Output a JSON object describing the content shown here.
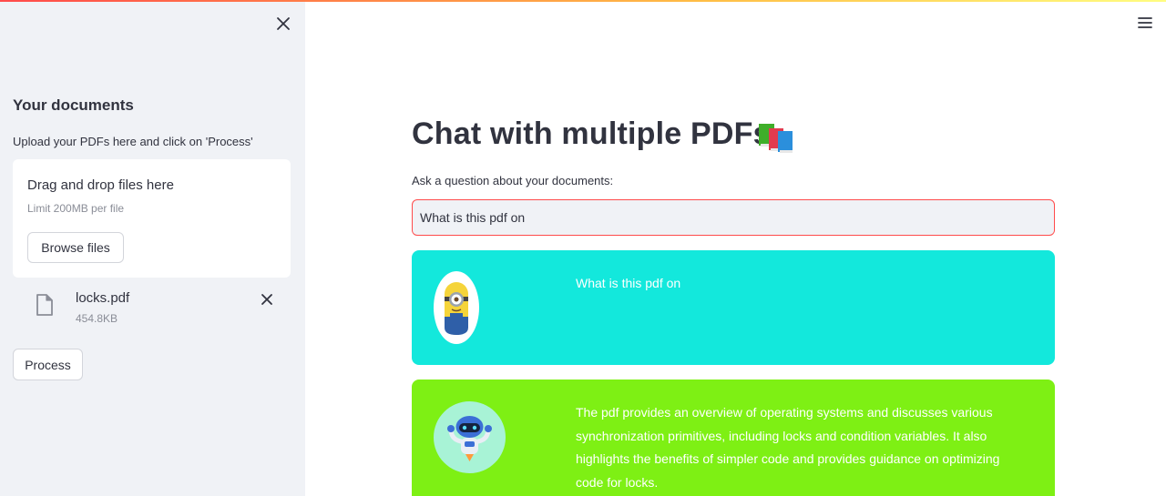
{
  "sidebar": {
    "title": "Your documents",
    "description": "Upload your PDFs here and click on 'Process'",
    "uploader": {
      "drag_text": "Drag and drop files here",
      "limit_text": "Limit 200MB per file",
      "browse_label": "Browse files"
    },
    "files": [
      {
        "name": "locks.pdf",
        "size": "454.8KB"
      }
    ],
    "process_label": "Process"
  },
  "main": {
    "title": "Chat with multiple PDFs",
    "title_icon": "books-icon",
    "question_label": "Ask a question about your documents:",
    "question_value": "What is this pdf on",
    "messages": [
      {
        "role": "user",
        "avatar": "minion-avatar",
        "text": "What is this pdf on"
      },
      {
        "role": "bot",
        "avatar": "robot-avatar",
        "text": "The pdf provides an overview of operating systems and discusses various synchronization primitives, including locks and condition variables. It also highlights the benefits of simpler code and provides guidance on optimizing code for locks."
      }
    ]
  },
  "colors": {
    "sidebar_bg": "#f0f2f6",
    "user_message_bg": "#13e8dc",
    "bot_message_bg": "#7ef014",
    "input_border_focus": "#ff4b4b",
    "accent_gradient_start": "#ff4b4b",
    "accent_gradient_end": "#fffd80"
  }
}
